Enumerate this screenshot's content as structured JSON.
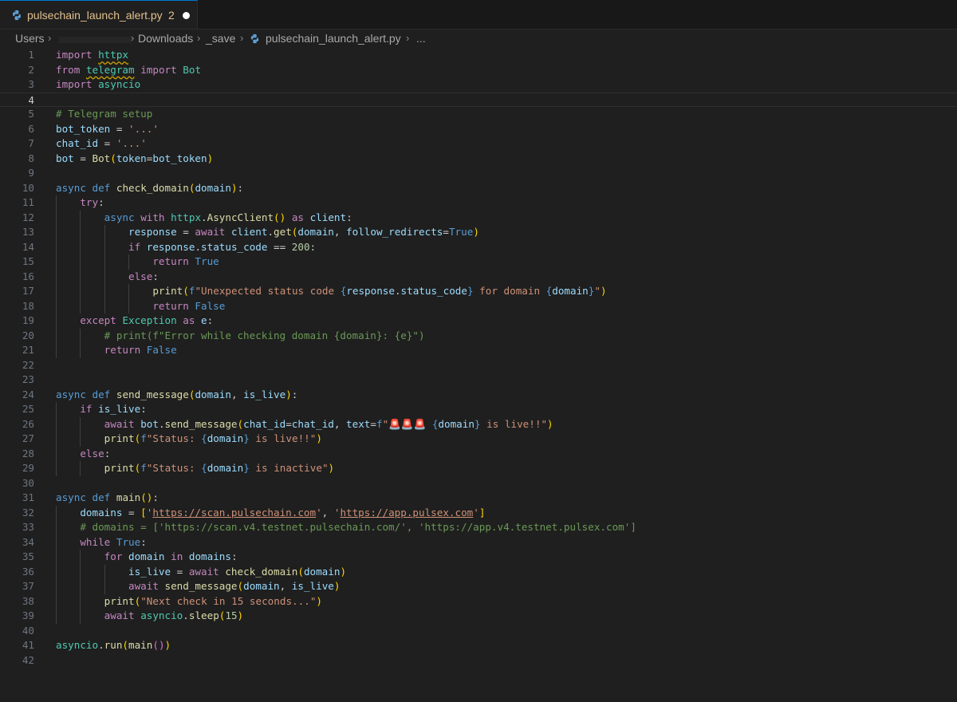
{
  "tab": {
    "title": "pulsechain_launch_alert.py",
    "badge": "2"
  },
  "breadcrumb": {
    "root": "Users",
    "folder1": "Downloads",
    "folder2": "_save",
    "file": "pulsechain_launch_alert.py",
    "more": "..."
  },
  "editor": {
    "current_line": 4,
    "lines": [
      {
        "n": "1",
        "text": "import httpx"
      },
      {
        "n": "2",
        "text": "from telegram import Bot"
      },
      {
        "n": "3",
        "text": "import asyncio"
      },
      {
        "n": "4",
        "text": ""
      },
      {
        "n": "5",
        "text": "# Telegram setup"
      },
      {
        "n": "6",
        "text": "bot_token = '...'"
      },
      {
        "n": "7",
        "text": "chat_id = '...'"
      },
      {
        "n": "8",
        "text": "bot = Bot(token=bot_token)"
      },
      {
        "n": "9",
        "text": ""
      },
      {
        "n": "10",
        "text": "async def check_domain(domain):"
      },
      {
        "n": "11",
        "text": "    try:"
      },
      {
        "n": "12",
        "text": "        async with httpx.AsyncClient() as client:"
      },
      {
        "n": "13",
        "text": "            response = await client.get(domain, follow_redirects=True)"
      },
      {
        "n": "14",
        "text": "            if response.status_code == 200:"
      },
      {
        "n": "15",
        "text": "                return True"
      },
      {
        "n": "16",
        "text": "            else:"
      },
      {
        "n": "17",
        "text": "                print(f\"Unexpected status code {response.status_code} for domain {domain}\")"
      },
      {
        "n": "18",
        "text": "                return False"
      },
      {
        "n": "19",
        "text": "    except Exception as e:"
      },
      {
        "n": "20",
        "text": "        # print(f\"Error while checking domain {domain}: {e}\")"
      },
      {
        "n": "21",
        "text": "        return False"
      },
      {
        "n": "22",
        "text": ""
      },
      {
        "n": "23",
        "text": ""
      },
      {
        "n": "24",
        "text": "async def send_message(domain, is_live):"
      },
      {
        "n": "25",
        "text": "    if is_live:"
      },
      {
        "n": "26",
        "text": "        await bot.send_message(chat_id=chat_id, text=f\"🚨🚨🚨 {domain} is live!!\")"
      },
      {
        "n": "27",
        "text": "        print(f\"Status: {domain} is live!!\")"
      },
      {
        "n": "28",
        "text": "    else:"
      },
      {
        "n": "29",
        "text": "        print(f\"Status: {domain} is inactive\")"
      },
      {
        "n": "30",
        "text": ""
      },
      {
        "n": "31",
        "text": "async def main():"
      },
      {
        "n": "32",
        "text": "    domains = ['https://scan.pulsechain.com', 'https://app.pulsex.com']"
      },
      {
        "n": "33",
        "text": "    # domains = ['https://scan.v4.testnet.pulsechain.com/', 'https://app.v4.testnet.pulsex.com']"
      },
      {
        "n": "34",
        "text": "    while True:"
      },
      {
        "n": "35",
        "text": "        for domain in domains:"
      },
      {
        "n": "36",
        "text": "            is_live = await check_domain(domain)"
      },
      {
        "n": "37",
        "text": "            await send_message(domain, is_live)"
      },
      {
        "n": "38",
        "text": "        print(\"Next check in 15 seconds...\")"
      },
      {
        "n": "39",
        "text": "        await asyncio.sleep(15)"
      },
      {
        "n": "40",
        "text": ""
      },
      {
        "n": "41",
        "text": "asyncio.run(main())"
      },
      {
        "n": "42",
        "text": ""
      }
    ]
  }
}
